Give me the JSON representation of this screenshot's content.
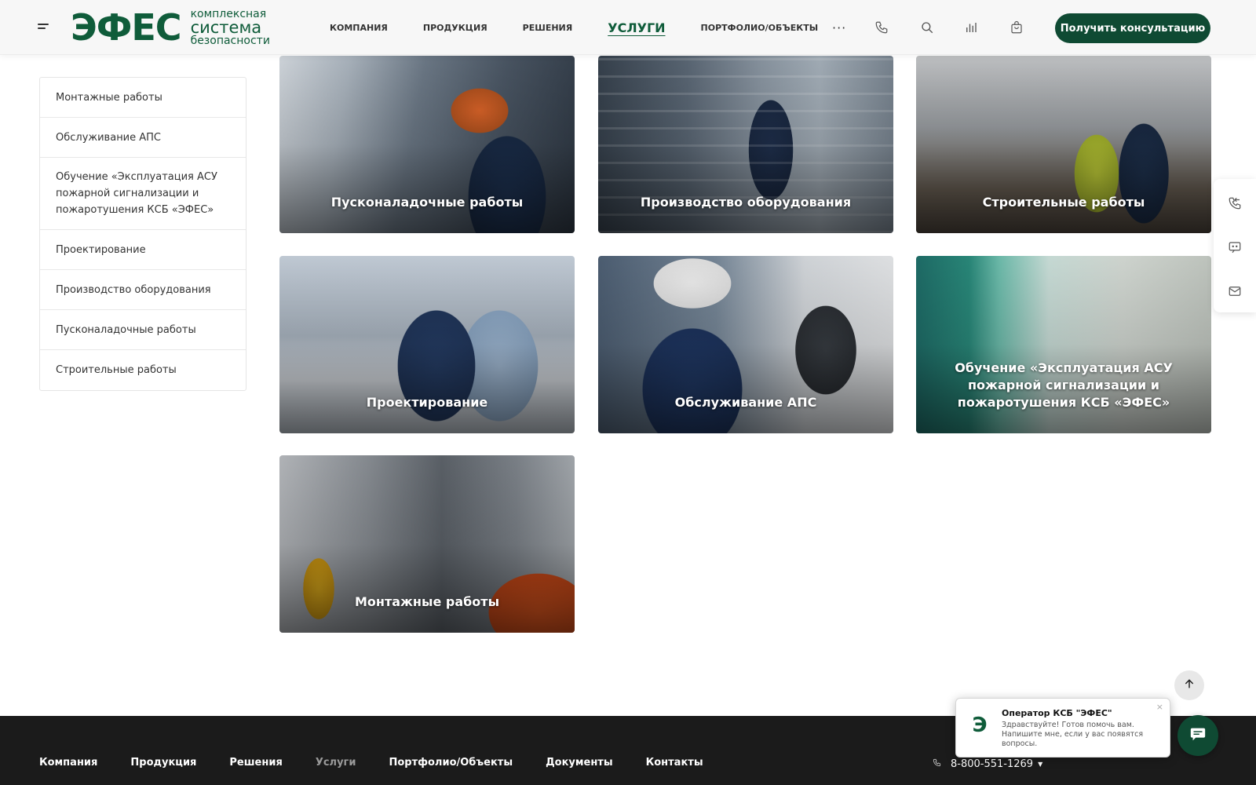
{
  "header": {
    "logo": {
      "mark": "ЭФЕС",
      "line1": "комплексная",
      "line2": "система",
      "line3": "безопасности"
    },
    "nav": [
      {
        "label": "Компания"
      },
      {
        "label": "Продукция"
      },
      {
        "label": "Решения"
      },
      {
        "label": "Услуги",
        "active": true
      },
      {
        "label": "Портфолио/Объекты"
      }
    ],
    "more": "···",
    "icons": [
      "phone-icon",
      "search-icon",
      "compare-icon",
      "cart-icon"
    ],
    "cta": "Получить консультацию"
  },
  "sidebar": {
    "items": [
      {
        "label": "Монтажные работы"
      },
      {
        "label": "Обслуживание АПС"
      },
      {
        "label": "Обучение «Эксплуатация АСУ пожарной сигнализации и пожаротушения КСБ «ЭФЕС»"
      },
      {
        "label": "Проектирование"
      },
      {
        "label": "Производство оборудования"
      },
      {
        "label": "Пусконаладочные работы"
      },
      {
        "label": "Строительные работы"
      }
    ]
  },
  "cards": [
    {
      "title": "Пусконаладочные работы"
    },
    {
      "title": "Производство оборудования"
    },
    {
      "title": "Строительные работы"
    },
    {
      "title": "Проектирование"
    },
    {
      "title": "Обслуживание АПС"
    },
    {
      "title": "Обучение «Эксплуатация АСУ пожарной сигнализации и пожаротушения КСБ «ЭФЕС»"
    },
    {
      "title": "Монтажные работы"
    }
  ],
  "right_panel": {
    "icons": [
      "callback-icon",
      "chat-icon",
      "mail-icon"
    ]
  },
  "footer": {
    "nav": [
      {
        "label": "Компания"
      },
      {
        "label": "Продукция"
      },
      {
        "label": "Решения"
      },
      {
        "label": "Услуги",
        "muted": true
      },
      {
        "label": "Портфолио/Объекты"
      },
      {
        "label": "Документы"
      },
      {
        "label": "Контакты"
      }
    ],
    "phone": "8-800-551-1269"
  },
  "chat": {
    "operator": "Оператор КСБ \"ЭФЕС\"",
    "message": "Здравствуйте! Готов помочь вам. Напишите мне, если у вас появятся вопросы.",
    "avatar_mark": "Э",
    "close": "×"
  },
  "colors": {
    "brand": "#0f5c3a",
    "cta_bg": "#0f4a33",
    "footer_bg": "#1b1b1b"
  }
}
